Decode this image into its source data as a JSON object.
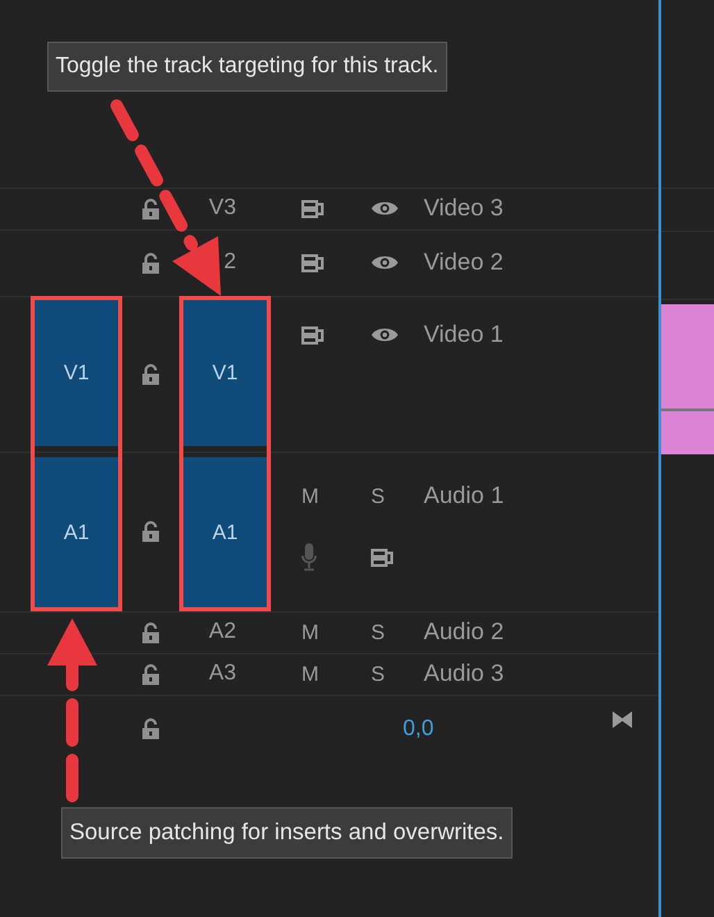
{
  "tooltips": [
    {
      "text": "Toggle the track targeting for this track."
    },
    {
      "text": "Source patching for inserts and overwrites."
    }
  ],
  "tracks": [
    {
      "kind": "video",
      "label": "V3",
      "name": "Video 3",
      "locked": false,
      "targeted": false
    },
    {
      "kind": "video",
      "label": "2",
      "name": "Video 2",
      "locked": false,
      "targeted": false
    },
    {
      "kind": "video",
      "label": "V1",
      "name": "Video 1",
      "locked": false,
      "targeted": true,
      "source": "V1"
    },
    {
      "kind": "audio",
      "label": "A1",
      "name": "Audio 1",
      "locked": false,
      "targeted": true,
      "source": "A1",
      "mute": "M",
      "solo": "S",
      "voiceover": true
    },
    {
      "kind": "audio",
      "label": "A2",
      "name": "Audio 2",
      "locked": false,
      "targeted": false,
      "mute": "M",
      "solo": "S"
    },
    {
      "kind": "audio",
      "label": "A3",
      "name": "Audio 3",
      "locked": false,
      "targeted": false,
      "mute": "M",
      "solo": "S"
    },
    {
      "kind": "master",
      "locked": false,
      "value": "0,0"
    }
  ]
}
